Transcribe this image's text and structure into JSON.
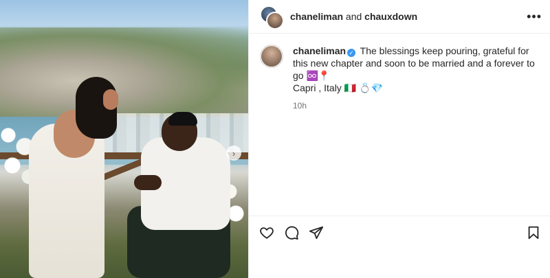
{
  "header": {
    "user_a": "chaneliman",
    "and_text": " and ",
    "user_b": "chauxdown",
    "more_icon": "more-icon"
  },
  "caption": {
    "username": "chaneliman",
    "verified_icon": "verified-badge-icon",
    "text_line": "The blessings keep pouring, grateful for this new chapter and soon to be married and a forever to go ♾️📍",
    "location": "Capri , Italy 🇮🇹 💍💎",
    "timestamp": "10h"
  },
  "media": {
    "next_icon": "chevron-right-icon"
  },
  "actions": {
    "like_icon": "heart-icon",
    "comment_icon": "comment-icon",
    "share_icon": "share-icon",
    "save_icon": "bookmark-icon"
  },
  "colors": {
    "accent": "#3897f0",
    "text": "#262626",
    "muted": "#737373",
    "border": "#efefef"
  }
}
